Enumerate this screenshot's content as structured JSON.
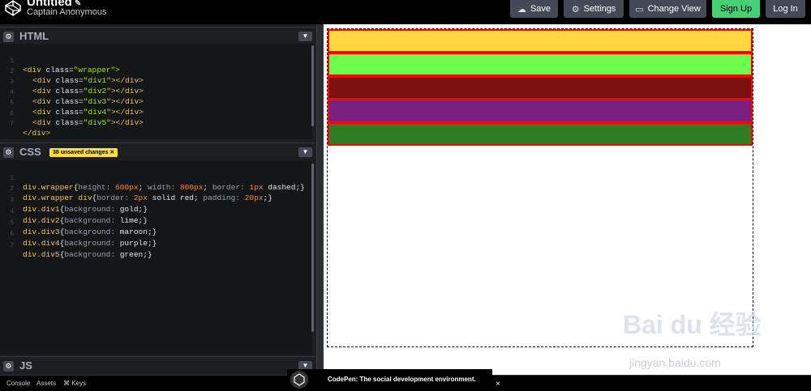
{
  "header": {
    "project_title": "Untitled",
    "owner": "Captain Anonymous",
    "buttons": {
      "save": "Save",
      "settings": "Settings",
      "change_view": "Change View",
      "sign_up": "Sign Up",
      "log_in": "Log In"
    }
  },
  "html_editor": {
    "title": "HTML",
    "line_numbers": [
      "1",
      "2",
      "3",
      "4",
      "5",
      "6",
      "7"
    ]
  },
  "css_editor": {
    "title": "CSS",
    "unsaved_badge": "38 unsaved changes",
    "line_numbers": [
      "1",
      "2",
      "3",
      "4",
      "5",
      "6",
      "7"
    ]
  },
  "js_editor": {
    "title": "JS"
  },
  "footer": {
    "console": "Console",
    "assets": "Assets",
    "keys": "⌘ Keys"
  },
  "toast": {
    "message": "CodePen: The social development environment.",
    "close": "×"
  },
  "preview": {
    "colors": {
      "div1": "#ffd740",
      "div2": "#6dfc4d",
      "div3": "#7a1010",
      "div4": "#7a1e80",
      "div5": "#2e7d22"
    }
  },
  "watermark": {
    "logo": "Bai du 经验",
    "url": "jingyan.baidu.com"
  }
}
